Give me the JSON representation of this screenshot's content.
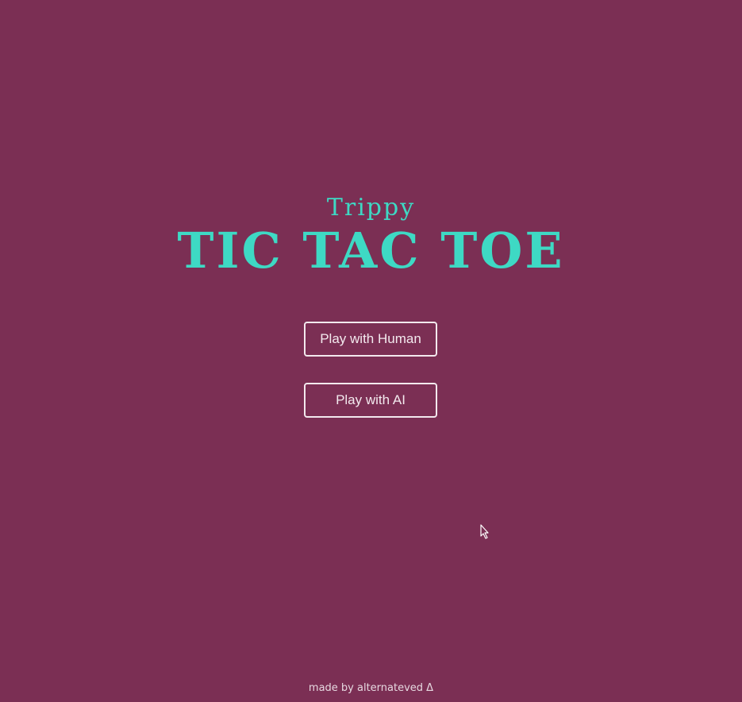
{
  "colors": {
    "background": "#7b2f54",
    "title": "#3ed9c4",
    "button_border": "#f3e9ee",
    "footer_text": "#e6d8e0"
  },
  "header": {
    "subtitle": "Trippy",
    "title": "TIC TAC TOE"
  },
  "menu": {
    "play_human_label": "Play with Human",
    "play_ai_label": "Play with AI"
  },
  "footer": {
    "text": "made by alternateved Δ"
  },
  "cursor": {
    "icon": "pointer-arrow-icon"
  }
}
